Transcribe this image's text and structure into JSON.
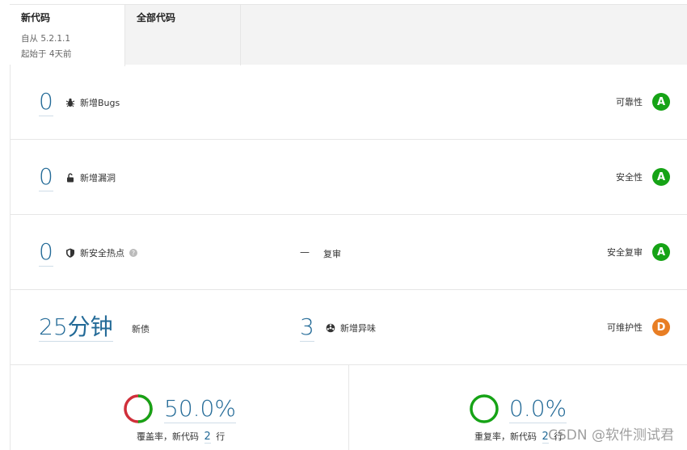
{
  "tabs": {
    "new_code": {
      "title": "新代码",
      "since": "自从 5.2.1.1",
      "started": "起始于 4天前"
    },
    "all_code": {
      "title": "全部代码"
    }
  },
  "rows": {
    "bugs": {
      "value": "0",
      "label": "新增Bugs",
      "rating_label": "可靠性",
      "rating": "A",
      "rating_color": "#16a316"
    },
    "vulns": {
      "value": "0",
      "label": "新增漏洞",
      "rating_label": "安全性",
      "rating": "A",
      "rating_color": "#16a316"
    },
    "hotspots": {
      "value": "0",
      "label": "新安全热点",
      "help": "?",
      "review_dash": "—",
      "review_label": "复审",
      "rating_label": "安全复审",
      "rating": "A",
      "rating_color": "#16a316"
    },
    "maint": {
      "debt_value": "25分钟",
      "debt_label": "新债",
      "smells_value": "3",
      "smells_label": "新增异味",
      "rating_label": "可维护性",
      "rating": "D",
      "rating_color": "#e87e24"
    }
  },
  "coverage": {
    "value": "50.0%",
    "label_prefix": "覆盖率，新代码",
    "lines": "2",
    "label_suffix": "行",
    "covered_fraction": 0.5
  },
  "duplication": {
    "value": "0.0%",
    "label_prefix": "重复率，新代码",
    "lines": "2",
    "label_suffix": "行"
  },
  "watermark": "CSDN @软件测试君"
}
